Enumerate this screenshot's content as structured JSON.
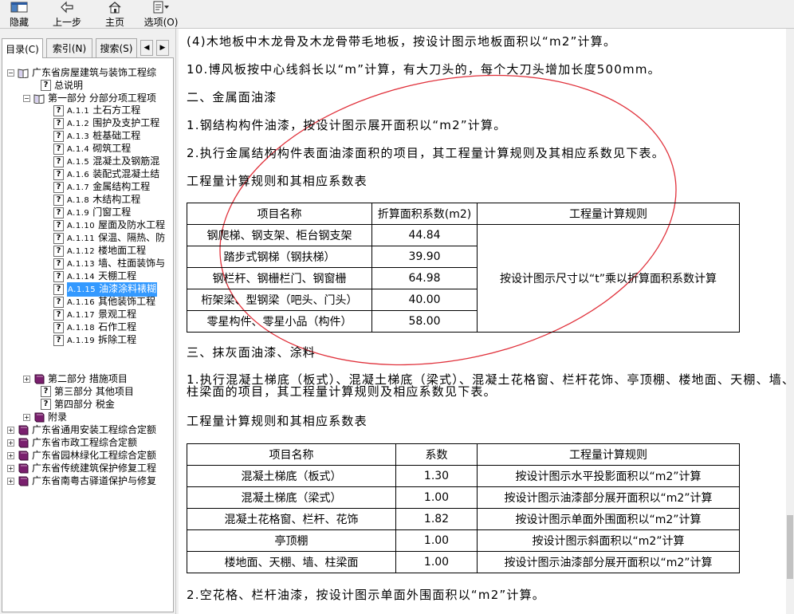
{
  "toolbar": {
    "hide_label": "隐藏",
    "back_label": "上一步",
    "home_label": "主页",
    "options_label": "选项(O)"
  },
  "tabs": {
    "contents": "目录(C)",
    "index": "索引(N)",
    "search": "搜索(S)"
  },
  "tree": {
    "root": "广东省房屋建筑与装饰工程综",
    "general": "总说明",
    "part1": "第一部分 分部分项工程项",
    "items": [
      {
        "code": "A.1.1",
        "label": "土石方工程"
      },
      {
        "code": "A.1.2",
        "label": "围护及支护工程"
      },
      {
        "code": "A.1.3",
        "label": "桩基础工程"
      },
      {
        "code": "A.1.4",
        "label": "砌筑工程"
      },
      {
        "code": "A.1.5",
        "label": "混凝土及钢筋混"
      },
      {
        "code": "A.1.6",
        "label": "装配式混凝土结"
      },
      {
        "code": "A.1.7",
        "label": "金属结构工程"
      },
      {
        "code": "A.1.8",
        "label": "木结构工程"
      },
      {
        "code": "A.1.9",
        "label": "门窗工程"
      },
      {
        "code": "A.1.10",
        "label": "屋面及防水工程"
      },
      {
        "code": "A.1.11",
        "label": "保温、隔热、防"
      },
      {
        "code": "A.1.12",
        "label": "楼地面工程"
      },
      {
        "code": "A.1.13",
        "label": "墙、柱面装饰与"
      },
      {
        "code": "A.1.14",
        "label": "天棚工程"
      },
      {
        "code": "A.1.15",
        "label": "油漆涂料裱糊"
      },
      {
        "code": "A.1.16",
        "label": "其他装饰工程"
      },
      {
        "code": "A.1.17",
        "label": "景观工程"
      },
      {
        "code": "A.1.18",
        "label": "石作工程"
      },
      {
        "code": "A.1.19",
        "label": "拆除工程"
      }
    ],
    "part2": "第二部分 措施项目",
    "part3": "第三部分 其他项目",
    "part4": "第四部分 税金",
    "appendix": "附录",
    "others": [
      "广东省通用安装工程综合定额",
      "广东省市政工程综合定额",
      "广东省园林绿化工程综合定额",
      "广东省传统建筑保护修复工程",
      "广东省南粤古驿道保护与修复"
    ]
  },
  "content": {
    "p1": "(4)木地板中木龙骨及木龙骨带毛地板，按设计图示地板面积以“m2”计算。",
    "p2": "10.博风板按中心线斜长以“m”计算，有大刀头的，每个大刀头增加长度500mm。",
    "h2": "二、金属面油漆",
    "p3": "1.钢结构构件油漆，按设计图示展开面积以“m2”计算。",
    "p4": "2.执行金属结构构件表面油漆面积的项目，其工程量计算规则及其相应系数见下表。",
    "t1_caption": "工程量计算规则和其相应系数表",
    "t1_headers": [
      "项目名称",
      "折算面积系数(m2)",
      "工程量计算规则"
    ],
    "t1_rows": [
      {
        "name": "钢爬梯、钢支架、柜台钢支架",
        "coef": "44.84"
      },
      {
        "name": "踏步式钢梯（钢扶梯）",
        "coef": "39.90"
      },
      {
        "name": "钢栏杆、钢栅栏门、钢窗栅",
        "coef": "64.98"
      },
      {
        "name": "桁架梁、型钢梁（吧头、门头）",
        "coef": "40.00"
      },
      {
        "name": "零星构件、零星小品（构件）",
        "coef": "58.00"
      }
    ],
    "t1_rule": "按设计图示尺寸以“t”乘以折算面积系数计算",
    "h3": "三、抹灰面油漆、涂料",
    "p5": "1.执行混凝土梯底（板式）、混凝土梯底（梁式）、混凝土花格窗、栏杆花饰、亭顶棚、楼地面、天棚、墙、柱梁面的项目，其工程量计算规则及相应系数见下表。",
    "t2_caption": "工程量计算规则和其相应系数表",
    "t2_headers": [
      "项目名称",
      "系数",
      "工程量计算规则"
    ],
    "t2_rows": [
      {
        "name": "混凝土梯底（板式）",
        "coef": "1.30",
        "rule": "按设计图示水平投影面积以“m2”计算"
      },
      {
        "name": "混凝土梯底（梁式）",
        "coef": "1.00",
        "rule": "按设计图示油漆部分展开面积以“m2”计算"
      },
      {
        "name": "混凝土花格窗、栏杆、花饰",
        "coef": "1.82",
        "rule": "按设计图示单面外围面积以“m2”计算"
      },
      {
        "name": "亭顶棚",
        "coef": "1.00",
        "rule": "按设计图示斜面积以“m2”计算"
      },
      {
        "name": "楼地面、天棚、墙、柱梁面",
        "coef": "1.00",
        "rule": "按设计图示油漆部分展开面积以“m2”计算"
      }
    ],
    "p6": "2.空花格、栏杆油漆，按设计图示单面外围面积以“m2”计算。"
  },
  "colors": {
    "selection": "#3399ff",
    "annotation": "#e0303a",
    "book_icon": "#7a1f6e"
  },
  "icons": [
    "hide-icon",
    "back-arrow-icon",
    "home-icon",
    "options-icon",
    "book-icon",
    "help-page-icon"
  ]
}
